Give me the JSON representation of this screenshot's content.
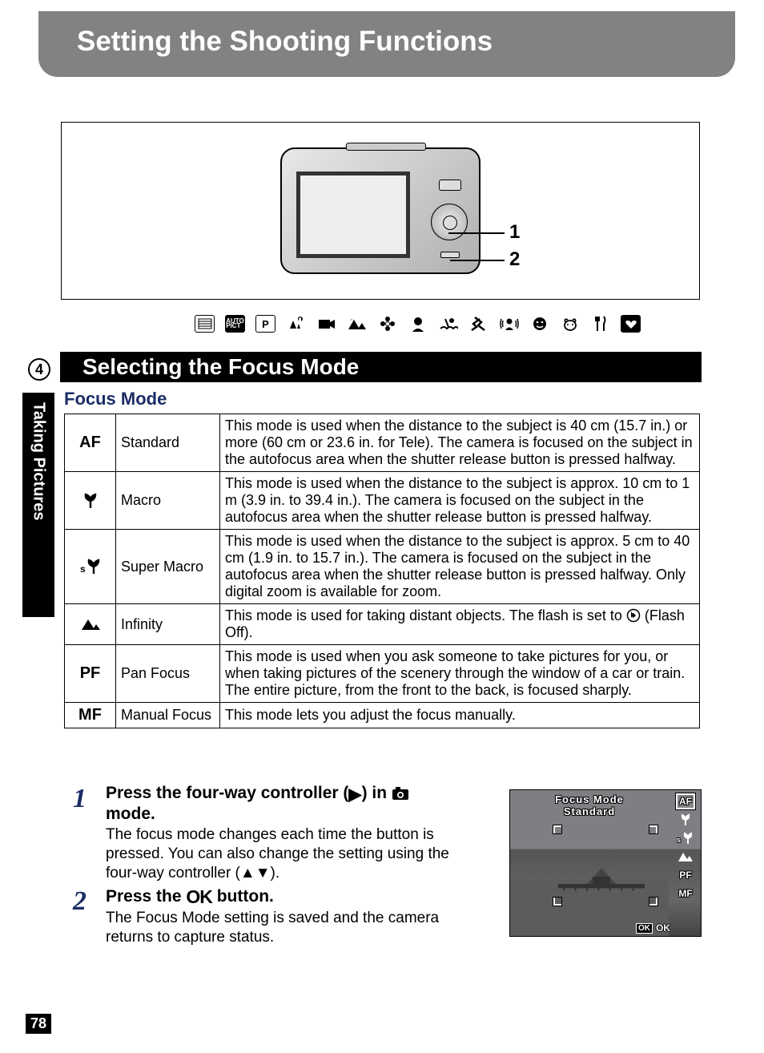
{
  "page": {
    "number": "78",
    "chapter": "4",
    "chapter_title": "Taking Pictures"
  },
  "title": "Setting the Shooting Functions",
  "diagram": {
    "labels": {
      "one": "1",
      "two": "2"
    }
  },
  "mode_icons": [
    "frame",
    "auto-pict",
    "program",
    "night",
    "movie",
    "landscape",
    "flower",
    "portrait",
    "surf",
    "sport",
    "stabilizer",
    "kids",
    "pet",
    "food",
    "heart"
  ],
  "section_title": "Selecting the Focus Mode",
  "table_heading": "Focus Mode",
  "focus_modes": [
    {
      "icon": "AF",
      "name": "Standard",
      "desc": "This mode is used when the distance to the subject is 40 cm (15.7 in.) or more (60 cm or 23.6 in. for Tele). The camera is focused on the subject in the autofocus area when the shutter release button is pressed halfway."
    },
    {
      "icon": "macro",
      "name": "Macro",
      "desc": "This mode is used when the distance to the subject is approx. 10 cm to 1 m (3.9 in. to 39.4 in.). The camera is focused on the subject in the autofocus area when the shutter release button is pressed halfway."
    },
    {
      "icon": "super-macro",
      "name": "Super Macro",
      "desc": "This mode is used when the distance to the subject is approx. 5 cm to 40 cm (1.9 in. to 15.7 in.). The camera is focused on the subject in the autofocus area when the shutter release button is pressed halfway. Only digital zoom is available for zoom."
    },
    {
      "icon": "infinity",
      "name": "Infinity",
      "desc_pre": "This mode is used for taking distant objects. The flash is set to ",
      "desc_post": " (Flash Off)."
    },
    {
      "icon": "PF",
      "name": "Pan Focus",
      "desc": "This mode is used when you ask someone to take pictures for you, or when taking pictures of the scenery through the window of a car or train. The entire picture, from the front to the back, is focused sharply."
    },
    {
      "icon": "MF",
      "name": "Manual Focus",
      "desc": "This mode lets you adjust the focus manually."
    }
  ],
  "steps": [
    {
      "num": "1",
      "head_pre": "Press the four-way controller (",
      "head_mid": ") in ",
      "head_post": " mode.",
      "body": "The focus mode changes each time the button is pressed. You can also change the setting using the four-way controller (▲▼)."
    },
    {
      "num": "2",
      "head_pre": "Press the ",
      "head_btn": "OK",
      "head_post": " button.",
      "body": "The Focus Mode setting is saved and the camera returns to capture status."
    }
  ],
  "lcd": {
    "line1": "Focus Mode",
    "line2": "Standard",
    "icons": [
      "AF",
      "macro",
      "super-macro",
      "infinity",
      "PF",
      "MF"
    ],
    "ok_box": "OK",
    "ok_text": "OK"
  },
  "glyphs": {
    "right": "▶",
    "up": "▲",
    "down": "▼",
    "camera": "◉"
  }
}
